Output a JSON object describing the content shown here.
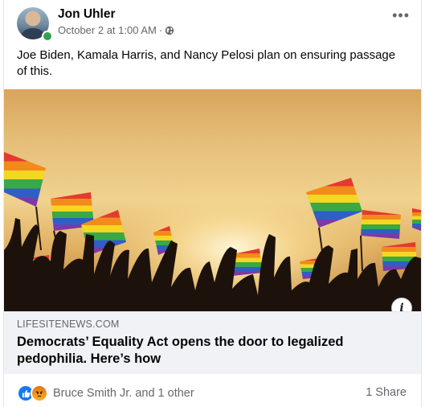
{
  "post": {
    "author": "Jon Uhler",
    "timestamp": "October 2 at 1:00 AM",
    "separator": "·",
    "audience_icon": "globe-icon",
    "text": "Joe Biden, Kamala Harris, and Nancy Pelosi plan on ensuring passage of this."
  },
  "link": {
    "domain": "LIFESITENEWS.COM",
    "headline": "Democrats’ Equality Act opens the door to legalized pedophilia. Here’s how",
    "info_label": "i"
  },
  "footer": {
    "reaction_icons": [
      "like-icon",
      "angry-icon"
    ],
    "reaction_names": "Bruce Smith Jr. and 1 other",
    "shares": "1 Share"
  },
  "menu": {
    "more_label": "•••"
  },
  "colors": {
    "online": "#31a24c",
    "like": "#1877f2",
    "angry": "#e9710f",
    "secondary_text": "#65676b"
  }
}
